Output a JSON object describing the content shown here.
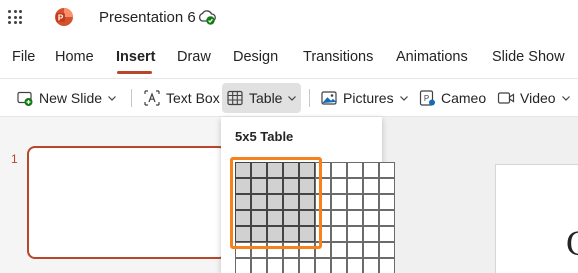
{
  "window": {
    "title": "Presentation 6"
  },
  "menu": {
    "tabs": [
      {
        "label": "File"
      },
      {
        "label": "Home"
      },
      {
        "label": "Insert",
        "active": true
      },
      {
        "label": "Draw"
      },
      {
        "label": "Design"
      },
      {
        "label": "Transitions"
      },
      {
        "label": "Animations"
      },
      {
        "label": "Slide Show"
      }
    ]
  },
  "ribbon": {
    "new_slide": "New Slide",
    "text_box": "Text Box",
    "table": "Table",
    "pictures": "Pictures",
    "cameo": "Cameo",
    "video": "Video"
  },
  "slides": {
    "number": "1",
    "canvas_text": "C"
  },
  "table_picker": {
    "title": "5x5 Table",
    "selected_rows": 5,
    "selected_cols": 5,
    "visible_rows": 7,
    "visible_cols": 10
  },
  "colors": {
    "accent": "#b7472a",
    "selection_frame": "#f7821b",
    "selected_cell": "#d1d1d1"
  },
  "icons": [
    "app-launcher-icon",
    "powerpoint-icon",
    "cloud-saved-icon",
    "new-slide-icon",
    "text-box-icon",
    "table-icon",
    "pictures-icon",
    "cameo-icon",
    "video-icon",
    "chevron-down-icon"
  ]
}
